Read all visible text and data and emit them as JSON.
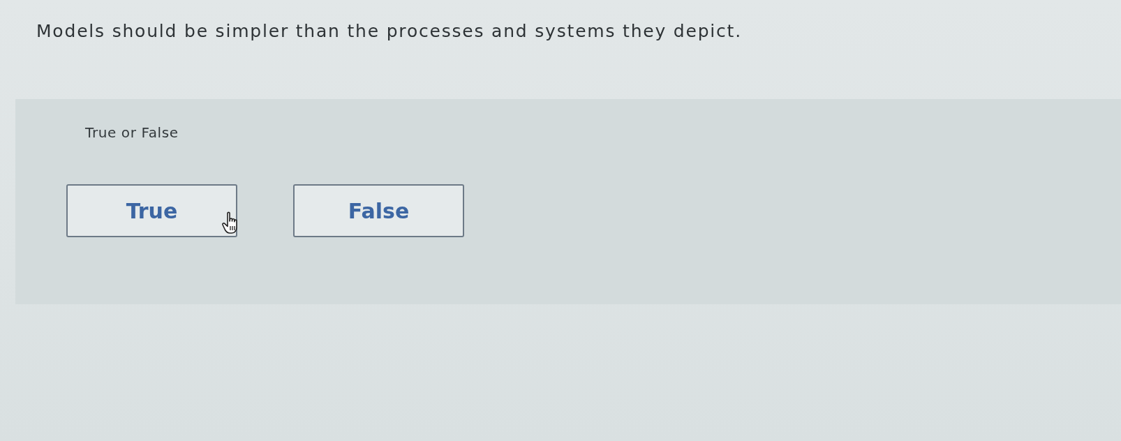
{
  "question": {
    "text": "Models should be simpler than the processes and systems they depict."
  },
  "answer_panel": {
    "prompt": "True or False",
    "options": [
      {
        "label": "True",
        "selected": false
      },
      {
        "label": "False",
        "selected": false
      }
    ]
  }
}
